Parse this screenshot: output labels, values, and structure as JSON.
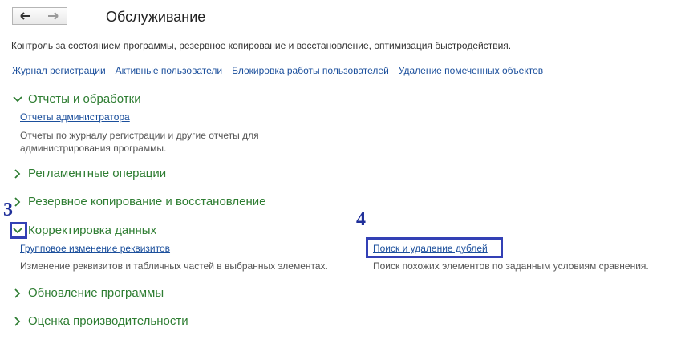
{
  "header": {
    "title": "Обслуживание",
    "description": "Контроль за состоянием программы, резервное копирование и восстановление, оптимизация быстродействия."
  },
  "top_links": [
    "Журнал регистрации",
    "Активные пользователи",
    "Блокировка работы пользователей",
    "Удаление помеченных объектов"
  ],
  "sections": {
    "reports": {
      "title": "Отчеты и обработки",
      "expanded": true,
      "link": "Отчеты администратора",
      "desc_line1": "Отчеты по журналу регистрации и другие отчеты для",
      "desc_line2": "администрирования программы."
    },
    "scheduled": {
      "title": "Регламентные операции",
      "expanded": false
    },
    "backup": {
      "title": "Резервное копирование и восстановление",
      "expanded": false
    },
    "correction": {
      "title": "Корректировка данных",
      "expanded": true,
      "link_left": "Групповое изменение реквизитов",
      "desc_left": "Изменение реквизитов и табличных частей в выбранных элементах.",
      "link_right": "Поиск и удаление дублей",
      "desc_right": "Поиск похожих элементов по заданным условиям сравнения."
    },
    "update": {
      "title": "Обновление программы",
      "expanded": false
    },
    "performance": {
      "title": "Оценка производительности",
      "expanded": false
    }
  },
  "annotations": {
    "marker_3": "3",
    "marker_4": "4",
    "color": "#3340b5"
  },
  "colors": {
    "section_green": "#2e7d32",
    "link_blue": "#1b4f9c"
  }
}
